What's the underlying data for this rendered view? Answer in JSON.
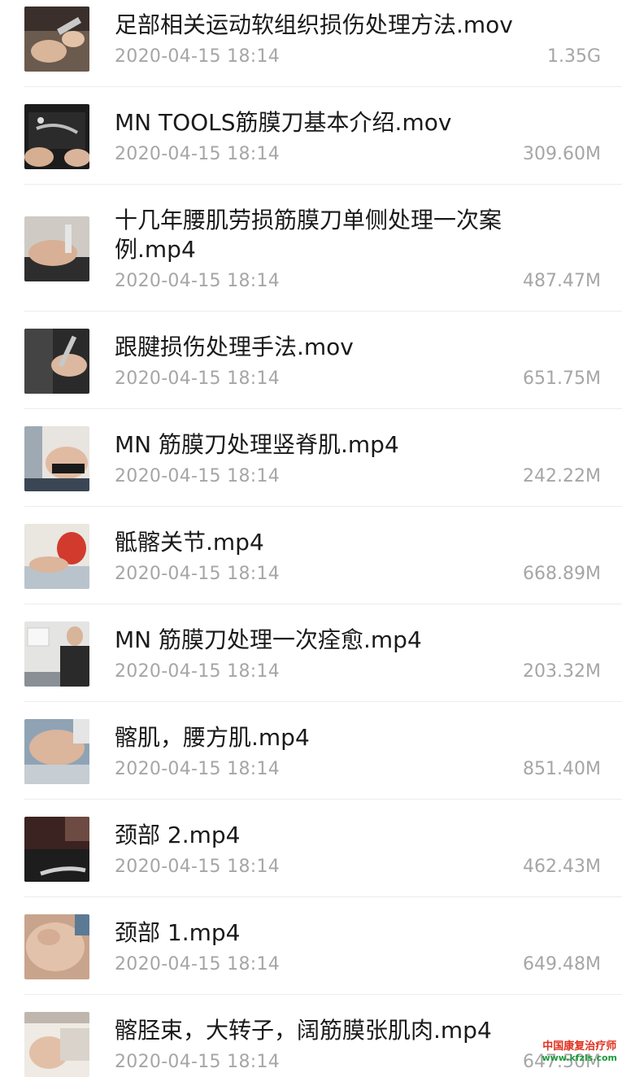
{
  "files": [
    {
      "name": "足部相关运动软组织损伤处理方法.mov",
      "date": "2020-04-15 18:14",
      "size": "1.35G",
      "thumb_icon": "video-thumbnail-icon"
    },
    {
      "name": "MN TOOLS筋膜刀基本介绍.mov",
      "date": "2020-04-15 18:14",
      "size": "309.60M",
      "thumb_icon": "video-thumbnail-icon"
    },
    {
      "name": "十几年腰肌劳损筋膜刀单侧处理一次案例.mp4",
      "date": "2020-04-15 18:14",
      "size": "487.47M",
      "thumb_icon": "video-thumbnail-icon"
    },
    {
      "name": "跟腱损伤处理手法.mov",
      "date": "2020-04-15 18:14",
      "size": "651.75M",
      "thumb_icon": "video-thumbnail-icon"
    },
    {
      "name": "MN 筋膜刀处理竖脊肌.mp4",
      "date": "2020-04-15 18:14",
      "size": "242.22M",
      "thumb_icon": "video-thumbnail-icon"
    },
    {
      "name": "骶髂关节.mp4",
      "date": "2020-04-15 18:14",
      "size": "668.89M",
      "thumb_icon": "video-thumbnail-icon"
    },
    {
      "name": "MN 筋膜刀处理一次痊愈.mp4",
      "date": "2020-04-15 18:14",
      "size": "203.32M",
      "thumb_icon": "video-thumbnail-icon"
    },
    {
      "name": "髂肌，腰方肌.mp4",
      "date": "2020-04-15 18:14",
      "size": "851.40M",
      "thumb_icon": "video-thumbnail-icon"
    },
    {
      "name": "颈部 2.mp4",
      "date": "2020-04-15 18:14",
      "size": "462.43M",
      "thumb_icon": "video-thumbnail-icon"
    },
    {
      "name": "颈部 1.mp4",
      "date": "2020-04-15 18:14",
      "size": "649.48M",
      "thumb_icon": "video-thumbnail-icon"
    },
    {
      "name": "髂胫束，大转子，阔筋膜张肌肉.mp4",
      "date": "2020-04-15 18:14",
      "size": "647.50M",
      "thumb_icon": "video-thumbnail-icon"
    }
  ],
  "watermark": {
    "text_cn": "中国康复治疗师",
    "text_url": "www.kfzls.com"
  },
  "colors": {
    "title": "#1a1a1a",
    "meta": "#a6a6a6",
    "divider": "#ececec",
    "watermark_red": "#e0301e",
    "watermark_green": "#1e9a3c"
  }
}
